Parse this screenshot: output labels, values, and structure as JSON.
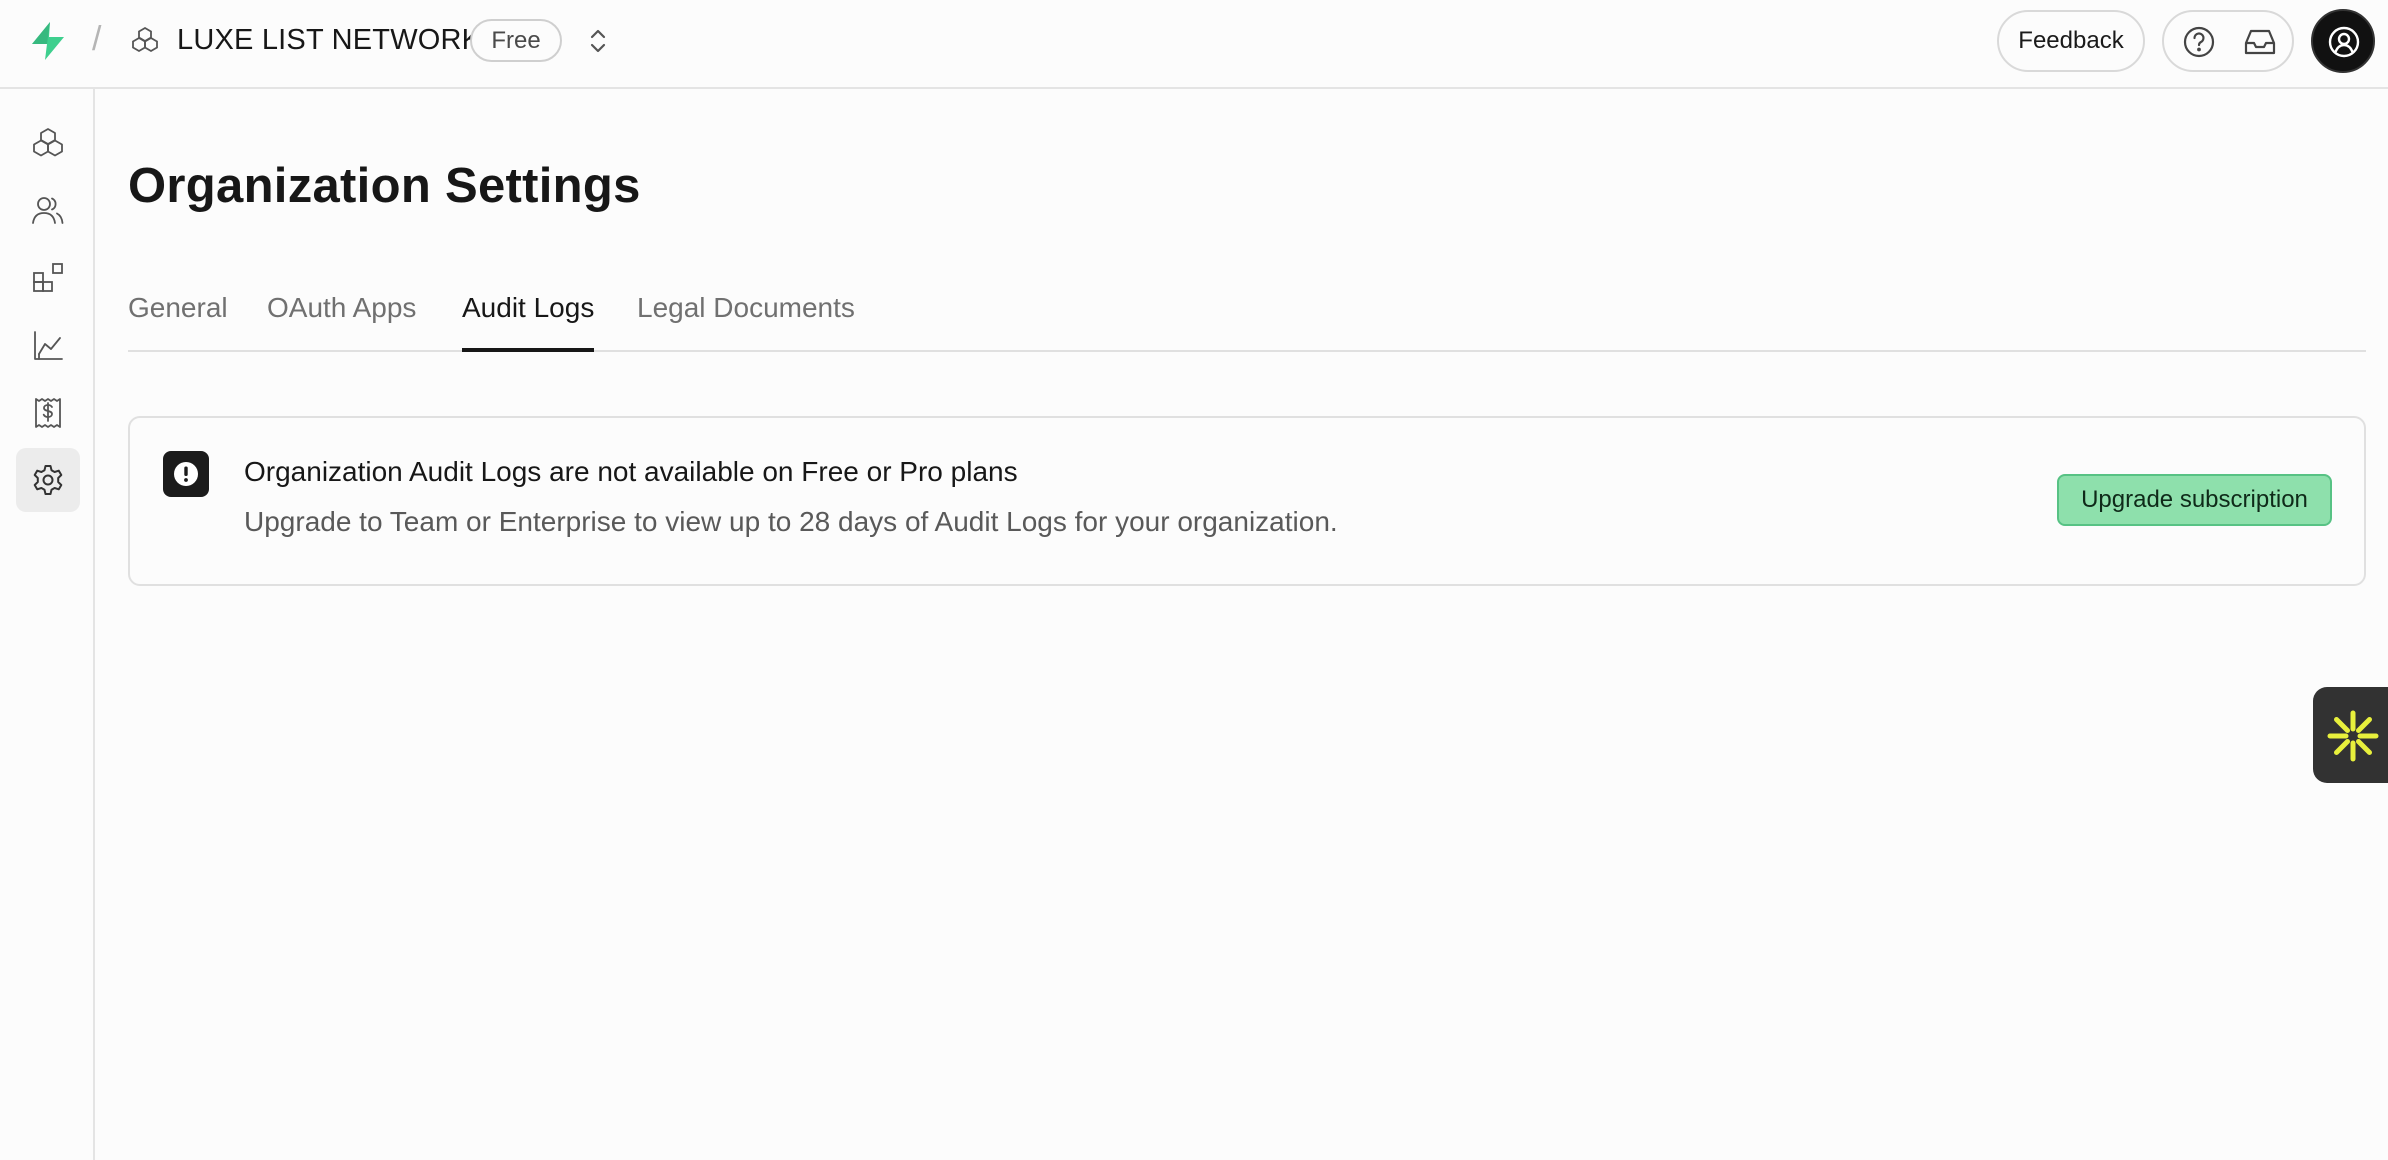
{
  "header": {
    "org_name": "LUXE LIST NETWORK",
    "separator": "/",
    "plan_badge": "Free",
    "feedback_label": "Feedback"
  },
  "sidebar": {
    "items": [
      {
        "id": "projects",
        "icon": "cubes-icon",
        "active": false
      },
      {
        "id": "team",
        "icon": "users-icon",
        "active": false
      },
      {
        "id": "integrations",
        "icon": "blocks-icon",
        "active": false
      },
      {
        "id": "usage",
        "icon": "chart-icon",
        "active": false
      },
      {
        "id": "billing",
        "icon": "receipt-dollar-icon",
        "active": false
      },
      {
        "id": "settings",
        "icon": "gear-icon",
        "active": true
      }
    ]
  },
  "main": {
    "title": "Organization Settings",
    "tabs": [
      {
        "label": "General",
        "active": false
      },
      {
        "label": "OAuth Apps",
        "active": false
      },
      {
        "label": "Audit Logs",
        "active": true
      },
      {
        "label": "Legal Documents",
        "active": false
      }
    ],
    "notice": {
      "icon": "alert-icon",
      "title": "Organization Audit Logs are not available on Free or Pro plans",
      "body": "Upgrade to Team or Enterprise to view up to 28 days of Audit Logs for your organization.",
      "button_label": "Upgrade subscription"
    }
  },
  "colors": {
    "brand_green": "#3ecf8e",
    "upgrade_button_bg": "#8ee0ac",
    "widget_bg": "#323232",
    "widget_accent": "#e8f03c"
  }
}
